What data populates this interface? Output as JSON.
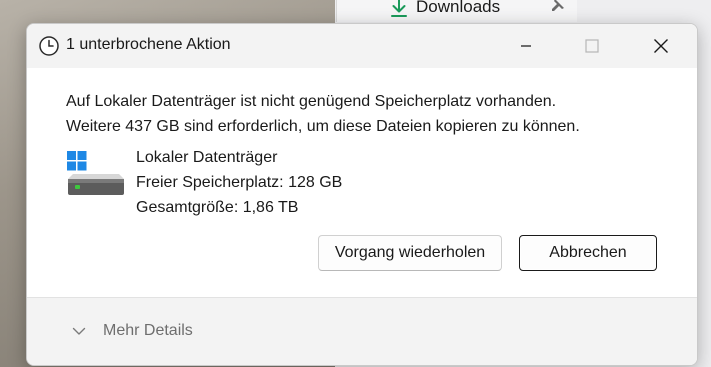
{
  "background": {
    "explorer_item_label": "Downloads",
    "download_icon": "download-arrow-icon",
    "pin_icon": "pin-icon"
  },
  "dialog": {
    "title": "1 unterbrochene Aktion",
    "title_icon": "clock-icon",
    "message_line1": "Auf Lokaler Datenträger ist nicht genügend Speicherplatz vorhanden.",
    "message_line2": "Weitere 437 GB sind erforderlich, um diese Dateien kopieren zu können.",
    "drive": {
      "icon": "drive-icon",
      "name": "Lokaler Datenträger",
      "free_space": "Freier Speicherplatz: 128 GB",
      "total_size": "Gesamtgröße: 1,86 TB"
    },
    "buttons": {
      "retry_label": "Vorgang wiederholen",
      "cancel_label": "Abbrechen"
    },
    "footer": {
      "more_details_label": "Mehr Details",
      "chevron_icon": "chevron-down-icon"
    }
  },
  "colors": {
    "accent_green": "#1a9a5a",
    "windows_blue": "#1e88e5",
    "drive_led": "#3ec93e"
  }
}
